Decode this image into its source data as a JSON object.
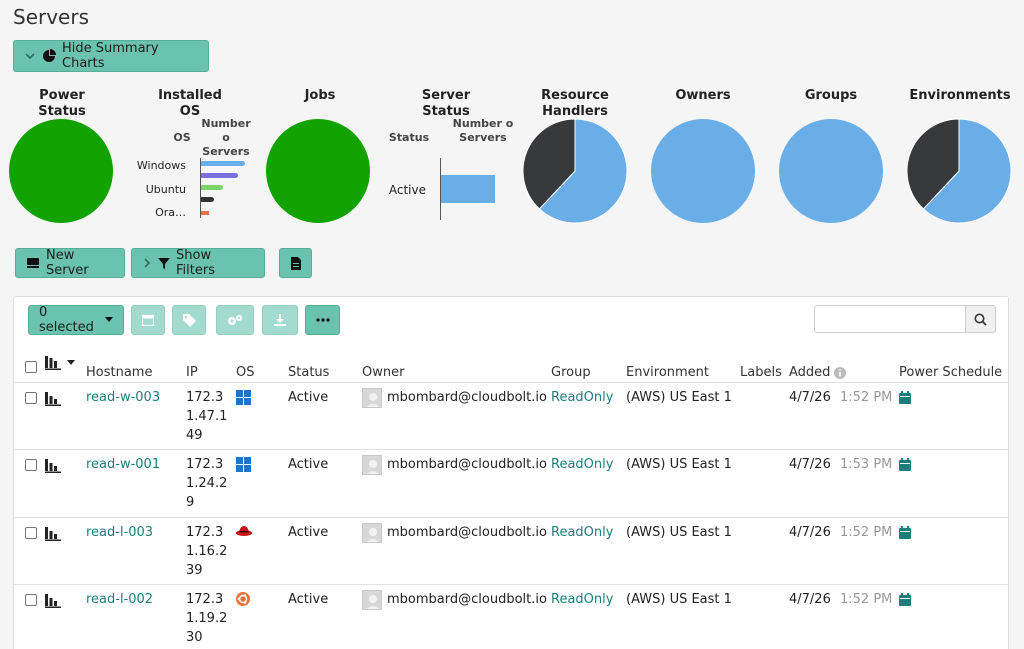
{
  "page": {
    "title": "Servers"
  },
  "toolbar": {
    "hide_charts_label": "Hide Summary Charts",
    "new_server_label": "New Server",
    "show_filters_label": "Show Filters",
    "selected_label": "0 selected"
  },
  "colors": {
    "accent": "#6bc2ae",
    "green": "#12a300",
    "blue": "#6aaee8",
    "dark": "#38393d",
    "link": "#1b7f79"
  },
  "charts": {
    "power": {
      "title_l1": "Power",
      "title_l2": "Status"
    },
    "os": {
      "title_l1": "Installed",
      "title_l2": "OS",
      "col1": "OS",
      "col2_l1": "Number o",
      "col2_l2": "Servers"
    },
    "jobs": {
      "title_l1": "Jobs"
    },
    "server_status": {
      "title_l1": "Server",
      "title_l2": "Status",
      "col1": "Status",
      "col2_l1": "Number o",
      "col2_l2": "Servers"
    },
    "resource_handlers": {
      "title_l1": "Resource",
      "title_l2": "Handlers"
    },
    "owners": {
      "title_l1": "Owners"
    },
    "groups": {
      "title_l1": "Groups"
    },
    "environments": {
      "title_l1": "Environments"
    }
  },
  "chart_data": [
    {
      "type": "pie",
      "values": [
        1
      ],
      "colors": [
        "#12a300"
      ]
    },
    {
      "type": "bar",
      "categories": [
        "Windows",
        "Ubuntu",
        "Ora…",
        ""
      ],
      "values": [
        2,
        1.7,
        1,
        0.6
      ],
      "colors": [
        "#6aaee8",
        "#7b6fe0",
        "#7cd36b",
        "#333333"
      ],
      "xlim": [
        0,
        2
      ],
      "last_bar_color": "#e8734a"
    },
    {
      "type": "pie",
      "values": [
        1
      ],
      "colors": [
        "#12a300"
      ]
    },
    {
      "type": "bar",
      "categories": [
        "Active"
      ],
      "values": [
        1
      ],
      "colors": [
        "#6aaee8"
      ],
      "xlim": [
        0,
        1
      ]
    },
    {
      "type": "pie",
      "values": [
        0.62,
        0.38
      ],
      "colors": [
        "#6aaee8",
        "#38393d"
      ]
    },
    {
      "type": "pie",
      "values": [
        1
      ],
      "colors": [
        "#6aaee8"
      ]
    },
    {
      "type": "pie",
      "values": [
        1
      ],
      "colors": [
        "#6aaee8"
      ]
    },
    {
      "type": "pie",
      "values": [
        0.62,
        0.38
      ],
      "colors": [
        "#6aaee8",
        "#38393d"
      ]
    }
  ],
  "table": {
    "columns": {
      "hostname": "Hostname",
      "ip": "IP",
      "os": "OS",
      "status": "Status",
      "owner": "Owner",
      "group": "Group",
      "environment": "Environment",
      "labels": "Labels",
      "added": "Added",
      "power_schedule": "Power Schedule"
    },
    "rows": [
      {
        "hostname": "read-w-003",
        "ip_l1": "172.3",
        "ip_l2": "1.47.1",
        "ip_l3": "49",
        "os_icon": "windows-icon",
        "status": "Active",
        "owner": "mbombard@cloudbolt.io",
        "group": "ReadOnly",
        "environment": "(AWS) US East 1",
        "date": "4/7/26",
        "time": "1:52 PM"
      },
      {
        "hostname": "read-w-001",
        "ip_l1": "172.3",
        "ip_l2": "1.24.2",
        "ip_l3": "9",
        "os_icon": "windows-icon",
        "status": "Active",
        "owner": "mbombard@cloudbolt.io",
        "group": "ReadOnly",
        "environment": "(AWS) US East 1",
        "date": "4/7/26",
        "time": "1:53 PM"
      },
      {
        "hostname": "read-l-003",
        "ip_l1": "172.3",
        "ip_l2": "1.16.2",
        "ip_l3": "39",
        "os_icon": "redhat-icon",
        "status": "Active",
        "owner": "mbombard@cloudbolt.io",
        "group": "ReadOnly",
        "environment": "(AWS) US East 1",
        "date": "4/7/26",
        "time": "1:52 PM"
      },
      {
        "hostname": "read-l-002",
        "ip_l1": "172.3",
        "ip_l2": "1.19.2",
        "ip_l3": "30",
        "os_icon": "ubuntu-icon",
        "status": "Active",
        "owner": "mbombard@cloudbolt.io",
        "group": "ReadOnly",
        "environment": "(AWS) US East 1",
        "date": "4/7/26",
        "time": "1:52 PM"
      }
    ]
  }
}
